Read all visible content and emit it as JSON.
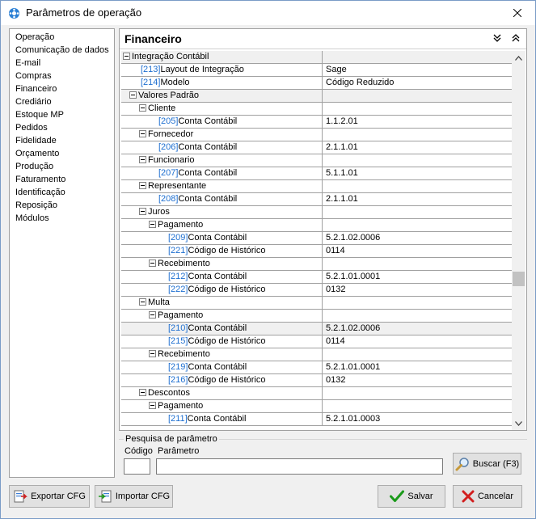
{
  "window": {
    "title": "Parâmetros de operação"
  },
  "sidebar": {
    "items": [
      {
        "label": "Operação"
      },
      {
        "label": "Comunicação de dados"
      },
      {
        "label": "E-mail"
      },
      {
        "label": "Compras"
      },
      {
        "label": "Financeiro"
      },
      {
        "label": "Crediário"
      },
      {
        "label": "Estoque MP"
      },
      {
        "label": "Pedidos"
      },
      {
        "label": "Fidelidade"
      },
      {
        "label": "Orçamento"
      },
      {
        "label": "Produção"
      },
      {
        "label": "Faturamento"
      },
      {
        "label": "Identificação"
      },
      {
        "label": "Reposição"
      },
      {
        "label": "Módulos"
      }
    ]
  },
  "panel": {
    "title": "Financeiro"
  },
  "grid": {
    "rows": [
      {
        "code": "",
        "name": "Integração Contábil",
        "value": "",
        "group": true
      },
      {
        "code": "[213]",
        "name": "Layout de Integração",
        "value": "Sage",
        "group": false
      },
      {
        "code": "[214]",
        "name": "Modelo",
        "value": "Código Reduzido",
        "group": false
      },
      {
        "code": "",
        "name": "Valores Padrão",
        "value": "",
        "group": true
      },
      {
        "code": "",
        "name": "Cliente",
        "value": "",
        "group": true
      },
      {
        "code": "[205]",
        "name": "Conta Contábil",
        "value": "1.1.2.01",
        "group": false
      },
      {
        "code": "",
        "name": "Fornecedor",
        "value": "",
        "group": true
      },
      {
        "code": "[206]",
        "name": "Conta Contábil",
        "value": "2.1.1.01",
        "group": false
      },
      {
        "code": "",
        "name": "Funcionario",
        "value": "",
        "group": true
      },
      {
        "code": "[207]",
        "name": "Conta Contábil",
        "value": "5.1.1.01",
        "group": false
      },
      {
        "code": "",
        "name": "Representante",
        "value": "",
        "group": true
      },
      {
        "code": "[208]",
        "name": "Conta Contábil",
        "value": "2.1.1.01",
        "group": false
      },
      {
        "code": "",
        "name": "Juros",
        "value": "",
        "group": true
      },
      {
        "code": "",
        "name": "Pagamento",
        "value": "",
        "group": true
      },
      {
        "code": "[209]",
        "name": "Conta Contábil",
        "value": "5.2.1.02.0006",
        "group": false
      },
      {
        "code": "[221]",
        "name": "Código de Histórico",
        "value": "0114",
        "group": false
      },
      {
        "code": "",
        "name": "Recebimento",
        "value": "",
        "group": true
      },
      {
        "code": "[212]",
        "name": "Conta Contábil",
        "value": "5.2.1.01.0001",
        "group": false
      },
      {
        "code": "[222]",
        "name": "Código de Histórico",
        "value": "0132",
        "group": false
      },
      {
        "code": "",
        "name": "Multa",
        "value": "",
        "group": true
      },
      {
        "code": "",
        "name": "Pagamento",
        "value": "",
        "group": true
      },
      {
        "code": "[210]",
        "name": "Conta Contábil",
        "value": "5.2.1.02.0006",
        "group": false
      },
      {
        "code": "[215]",
        "name": "Código de Histórico",
        "value": "0114",
        "group": false
      },
      {
        "code": "",
        "name": "Recebimento",
        "value": "",
        "group": true
      },
      {
        "code": "[219]",
        "name": "Conta Contábil",
        "value": "5.2.1.01.0001",
        "group": false
      },
      {
        "code": "[216]",
        "name": "Código de Histórico",
        "value": "0132",
        "group": false
      },
      {
        "code": "",
        "name": "Descontos",
        "value": "",
        "group": true
      },
      {
        "code": "",
        "name": "Pagamento",
        "value": "",
        "group": true
      },
      {
        "code": "[211]",
        "name": "Conta Contábil",
        "value": "5.2.1.01.0003",
        "group": false
      }
    ]
  },
  "search": {
    "legend": "Pesquisa de parâmetro",
    "codigo_label": "Código",
    "parametro_label": "Parâmetro",
    "codigo_value": "",
    "parametro_value": "",
    "search_button": "Buscar (F3)"
  },
  "footer": {
    "export_label": "Exportar CFG",
    "import_label": "Importar CFG",
    "save_label": "Salvar",
    "cancel_label": "Cancelar"
  },
  "colors": {
    "code_blue": "#1e6fd0",
    "save_green": "#1a9a1a",
    "cancel_red": "#d21f1f"
  }
}
